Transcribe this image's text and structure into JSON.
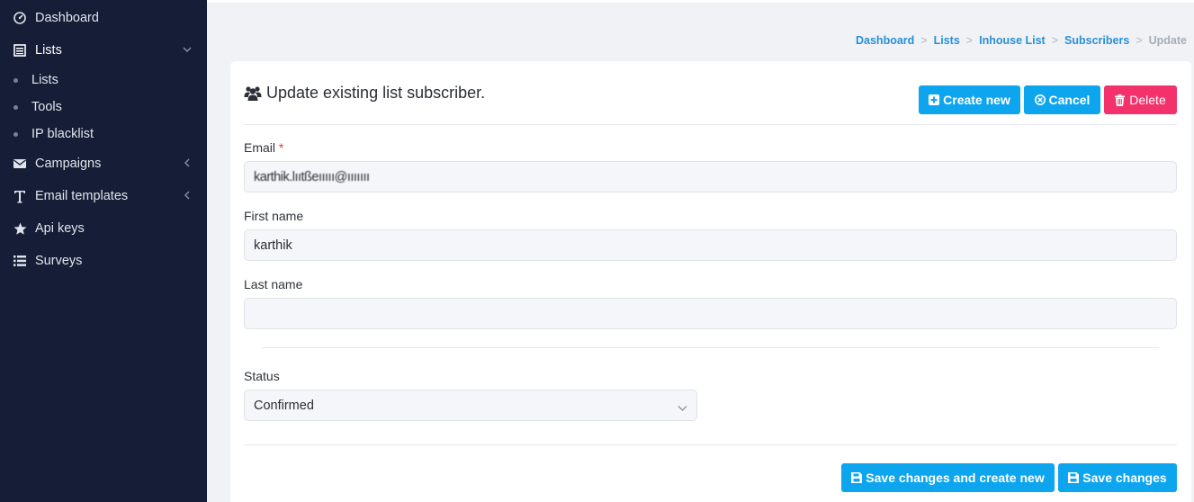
{
  "sidebar": {
    "items": [
      {
        "label": "Dashboard",
        "icon": "dashboard-icon"
      },
      {
        "label": "Lists",
        "icon": "list-icon",
        "expanded": true
      },
      {
        "label": "Campaigns",
        "icon": "envelope-icon"
      },
      {
        "label": "Email templates",
        "icon": "text-icon"
      },
      {
        "label": "Api keys",
        "icon": "star-icon"
      },
      {
        "label": "Surveys",
        "icon": "list-lines-icon"
      }
    ],
    "sub_items": [
      {
        "label": "Lists"
      },
      {
        "label": "Tools"
      },
      {
        "label": "IP blacklist"
      }
    ]
  },
  "breadcrumb": {
    "items": [
      "Dashboard",
      "Lists",
      "Inhouse List",
      "Subscribers"
    ],
    "current": "Update",
    "separator": ">"
  },
  "card": {
    "title": "Update existing list subscriber.",
    "title_icon": "users-icon",
    "buttons": {
      "create_new": "Create new",
      "cancel": "Cancel",
      "delete": "Delete"
    }
  },
  "form": {
    "email_label": "Email",
    "email_required_mark": "*",
    "email_value": "karthik.lııtßeııııı@ııııııı",
    "first_name_label": "First name",
    "first_name_value": "karthik",
    "last_name_label": "Last name",
    "last_name_value": "",
    "status_label": "Status",
    "status_value": "Confirmed"
  },
  "footer_buttons": {
    "save_and_create": "Save changes and create new",
    "save": "Save changes"
  },
  "colors": {
    "sidebar_bg": "#161d36",
    "accent_blue": "#0ea5ef",
    "danger": "#f3326b",
    "link": "#2b8fd6"
  }
}
